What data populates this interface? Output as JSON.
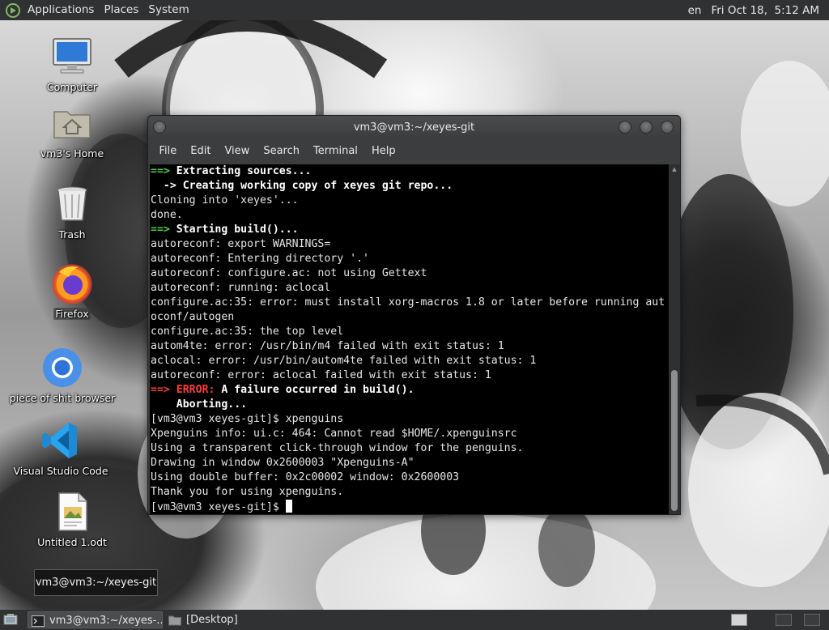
{
  "top_panel": {
    "menus": [
      "Applications",
      "Places",
      "System"
    ],
    "keyboard_layout": "en",
    "clock": "Fri Oct 18,  5:12 AM"
  },
  "desktop_icons": [
    {
      "label": "Computer",
      "icon": "computer-icon"
    },
    {
      "label": "vm3's Home",
      "icon": "home-folder-icon"
    },
    {
      "label": "Trash",
      "icon": "trash-icon"
    },
    {
      "label": "Firefox",
      "icon": "firefox-icon"
    },
    {
      "label": "piece of shit browser",
      "icon": "chromium-icon"
    },
    {
      "label": "Visual Studio Code",
      "icon": "vscode-icon"
    },
    {
      "label": "Untitled 1.odt",
      "icon": "document-icon"
    }
  ],
  "terminal": {
    "title": "vm3@vm3:~/xeyes-git",
    "menu": [
      "File",
      "Edit",
      "View",
      "Search",
      "Terminal",
      "Help"
    ],
    "lines": [
      {
        "prefix": "==>",
        "prefix_style": "g",
        "text": " Extracting sources...",
        "style": "b"
      },
      {
        "prefix": "",
        "prefix_style": "",
        "text": "  -> Creating working copy of xeyes git repo...",
        "style": "b"
      },
      {
        "prefix": "",
        "prefix_style": "",
        "text": "Cloning into 'xeyes'...",
        "style": ""
      },
      {
        "prefix": "",
        "prefix_style": "",
        "text": "done.",
        "style": ""
      },
      {
        "prefix": "==>",
        "prefix_style": "g",
        "text": " Starting build()...",
        "style": "b"
      },
      {
        "prefix": "",
        "prefix_style": "",
        "text": "autoreconf: export WARNINGS=",
        "style": ""
      },
      {
        "prefix": "",
        "prefix_style": "",
        "text": "autoreconf: Entering directory '.'",
        "style": ""
      },
      {
        "prefix": "",
        "prefix_style": "",
        "text": "autoreconf: configure.ac: not using Gettext",
        "style": ""
      },
      {
        "prefix": "",
        "prefix_style": "",
        "text": "autoreconf: running: aclocal",
        "style": ""
      },
      {
        "prefix": "",
        "prefix_style": "",
        "text": "configure.ac:35: error: must install xorg-macros 1.8 or later before running aut",
        "style": ""
      },
      {
        "prefix": "",
        "prefix_style": "",
        "text": "oconf/autogen",
        "style": ""
      },
      {
        "prefix": "",
        "prefix_style": "",
        "text": "configure.ac:35: the top level",
        "style": ""
      },
      {
        "prefix": "",
        "prefix_style": "",
        "text": "autom4te: error: /usr/bin/m4 failed with exit status: 1",
        "style": ""
      },
      {
        "prefix": "",
        "prefix_style": "",
        "text": "aclocal: error: /usr/bin/autom4te failed with exit status: 1",
        "style": ""
      },
      {
        "prefix": "",
        "prefix_style": "",
        "text": "autoreconf: error: aclocal failed with exit status: 1",
        "style": ""
      },
      {
        "prefix": "==> ERROR:",
        "prefix_style": "r",
        "text": " A failure occurred in build().",
        "style": "b"
      },
      {
        "prefix": "",
        "prefix_style": "",
        "text": "    Aborting...",
        "style": "b"
      },
      {
        "prefix": "",
        "prefix_style": "",
        "text": "[vm3@vm3 xeyes-git]$ xpenguins",
        "style": ""
      },
      {
        "prefix": "",
        "prefix_style": "",
        "text": "Xpenguins info: ui.c: 464: Cannot read $HOME/.xpenguinsrc",
        "style": ""
      },
      {
        "prefix": "",
        "prefix_style": "",
        "text": "Using a transparent click-through window for the penguins.",
        "style": ""
      },
      {
        "prefix": "",
        "prefix_style": "",
        "text": "Drawing in window 0x2600003 \"Xpenguins-A\"",
        "style": ""
      },
      {
        "prefix": "",
        "prefix_style": "",
        "text": "Using double buffer: 0x2c00002 window: 0x2600003",
        "style": ""
      },
      {
        "prefix": "",
        "prefix_style": "",
        "text": "Thank you for using xpenguins.",
        "style": ""
      }
    ],
    "prompt": "[vm3@vm3 xeyes-git]$ "
  },
  "tooltip": "vm3@vm3:~/xeyes-git",
  "taskbar": {
    "tasks": [
      {
        "label": "vm3@vm3:~/xeyes-...",
        "icon": "terminal-icon",
        "active": true
      },
      {
        "label": "[Desktop]",
        "icon": "folder-icon",
        "active": false
      }
    ]
  }
}
